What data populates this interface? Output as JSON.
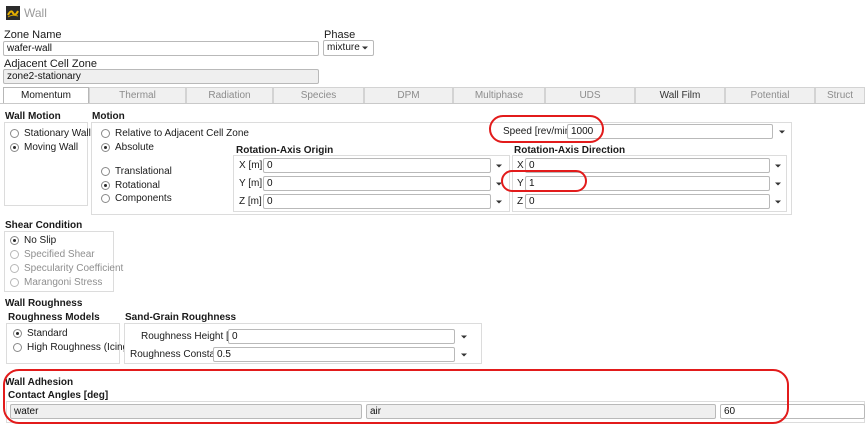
{
  "window": {
    "title": "Wall"
  },
  "zone_name": {
    "label": "Zone Name",
    "value": "wafer-wall"
  },
  "phase": {
    "label": "Phase",
    "value": "mixture"
  },
  "adjacent_cell_zone": {
    "label": "Adjacent Cell Zone",
    "value": "zone2-stationary"
  },
  "tabs": [
    {
      "label": "Momentum",
      "active": true
    },
    {
      "label": "Thermal"
    },
    {
      "label": "Radiation"
    },
    {
      "label": "Species"
    },
    {
      "label": "DPM"
    },
    {
      "label": "Multiphase"
    },
    {
      "label": "UDS"
    },
    {
      "label": "Wall Film"
    },
    {
      "label": "Potential"
    },
    {
      "label": "Struct"
    }
  ],
  "wall_motion": {
    "title": "Wall Motion",
    "options": [
      {
        "label": "Stationary Wall",
        "selected": false
      },
      {
        "label": "Moving Wall",
        "selected": true
      }
    ]
  },
  "motion": {
    "title": "Motion",
    "frame": [
      {
        "label": "Relative to Adjacent Cell Zone",
        "selected": false
      },
      {
        "label": "Absolute",
        "selected": true
      }
    ],
    "type": [
      {
        "label": "Translational",
        "selected": false
      },
      {
        "label": "Rotational",
        "selected": true
      },
      {
        "label": "Components",
        "selected": false
      }
    ],
    "speed": {
      "label": "Speed [rev/min]",
      "value": "1000"
    },
    "origin": {
      "title": "Rotation-Axis Origin",
      "x": {
        "label": "X [m]",
        "value": "0"
      },
      "y": {
        "label": "Y [m]",
        "value": "0"
      },
      "z": {
        "label": "Z [m]",
        "value": "0"
      }
    },
    "direction": {
      "title": "Rotation-Axis Direction",
      "x": {
        "label": "X",
        "value": "0"
      },
      "y": {
        "label": "Y",
        "value": "1"
      },
      "z": {
        "label": "Z",
        "value": "0"
      }
    }
  },
  "shear_condition": {
    "title": "Shear Condition",
    "options": [
      {
        "label": "No Slip",
        "selected": true,
        "enabled": true
      },
      {
        "label": "Specified Shear",
        "selected": false,
        "enabled": false
      },
      {
        "label": "Specularity Coefficient",
        "selected": false,
        "enabled": false
      },
      {
        "label": "Marangoni Stress",
        "selected": false,
        "enabled": false
      }
    ]
  },
  "wall_roughness": {
    "title": "Wall Roughness",
    "models": {
      "title": "Roughness Models",
      "options": [
        {
          "label": "Standard",
          "selected": true
        },
        {
          "label": "High Roughness (Icing)",
          "selected": false
        }
      ]
    },
    "sand_grain": {
      "title": "Sand-Grain Roughness",
      "height": {
        "label": "Roughness Height [m]",
        "value": "0"
      },
      "constant": {
        "label": "Roughness Constant",
        "value": "0.5"
      }
    }
  },
  "wall_adhesion": {
    "title": "Wall Adhesion",
    "contact_angles": {
      "title": "Contact Angles [deg]",
      "phase1": "water",
      "phase2": "air",
      "value": "60"
    }
  },
  "icons": {
    "app": "fluent-wall-icon",
    "dropdown": "chevron-down-icon"
  },
  "colors": {
    "highlight": "#e21b1b",
    "tab_active_bg": "#ffffff",
    "tab_inactive_bg": "#f0f0f0",
    "readonly_field_bg": "#efefef"
  }
}
